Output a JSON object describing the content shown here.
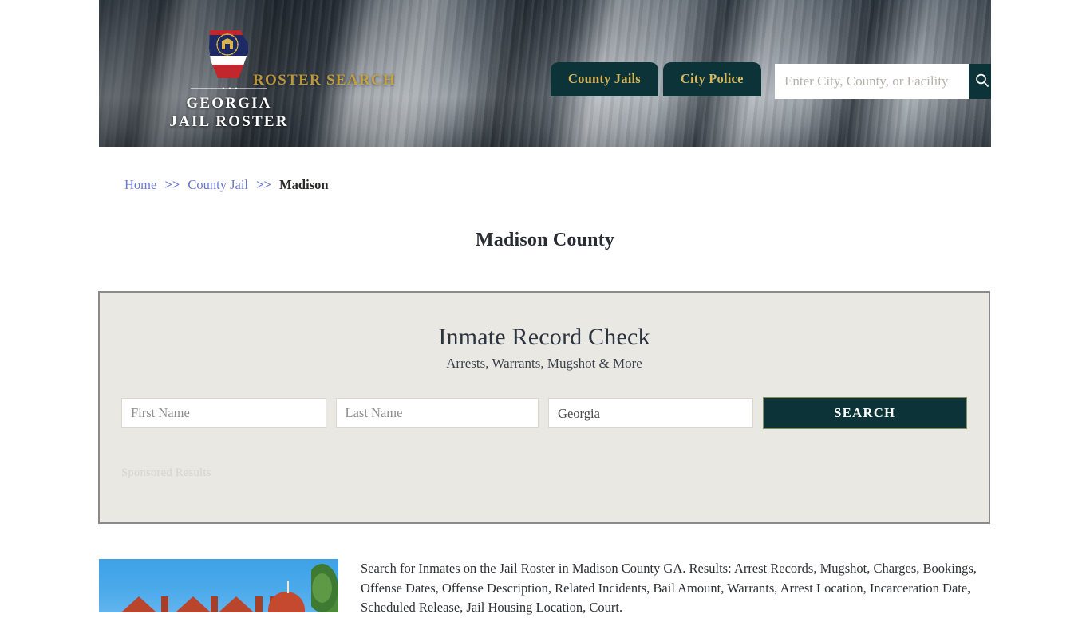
{
  "header": {
    "brand_line1": "GEORGIA",
    "brand_line2": "JAIL ROSTER",
    "logo_icon": "georgia-state-flag-icon",
    "tagline": "ROSTER SEARCH",
    "nav": [
      {
        "label": "County Jails",
        "name": "county-jails"
      },
      {
        "label": "City Police",
        "name": "city-police"
      }
    ],
    "search": {
      "placeholder": "Enter City, County, or Facility",
      "value": "",
      "icon": "search-icon"
    },
    "colors": {
      "nav_background": "#0b3338",
      "nav_text": "#d6b75e",
      "tagline": "#c9a23d"
    }
  },
  "breadcrumb": {
    "items": [
      {
        "label": "Home",
        "current": false
      },
      {
        "label": "County Jail",
        "current": false
      },
      {
        "label": "Madison",
        "current": true
      }
    ],
    "separator": ">>",
    "link_color": "#6a78cf"
  },
  "page": {
    "title": "Madison County"
  },
  "inmate_panel": {
    "title": "Inmate Record Check",
    "subtitle": "Arrests, Warrants, Mugshot & More",
    "first_name": {
      "placeholder": "First Name",
      "value": ""
    },
    "last_name": {
      "placeholder": "Last Name",
      "value": ""
    },
    "state": {
      "selected": "Georgia",
      "options": [
        "Georgia"
      ]
    },
    "search_button": "SEARCH",
    "sponsored_label": "Sponsored Results",
    "colors": {
      "background": "#e9e8e3",
      "border": "#8a8a8a",
      "button": "#0b3338"
    }
  },
  "content": {
    "photo_alt": "madison-county-courthouse-photo",
    "body": "Search for Inmates on the Jail Roster in Madison County GA. Results: Arrest Records, Mugshot, Charges, Bookings, Offense Dates, Offense Description, Related Incidents, Bail Amount, Warrants, Arrest Location, Incarceration Date, Scheduled Release, Jail Housing Location, Court."
  }
}
